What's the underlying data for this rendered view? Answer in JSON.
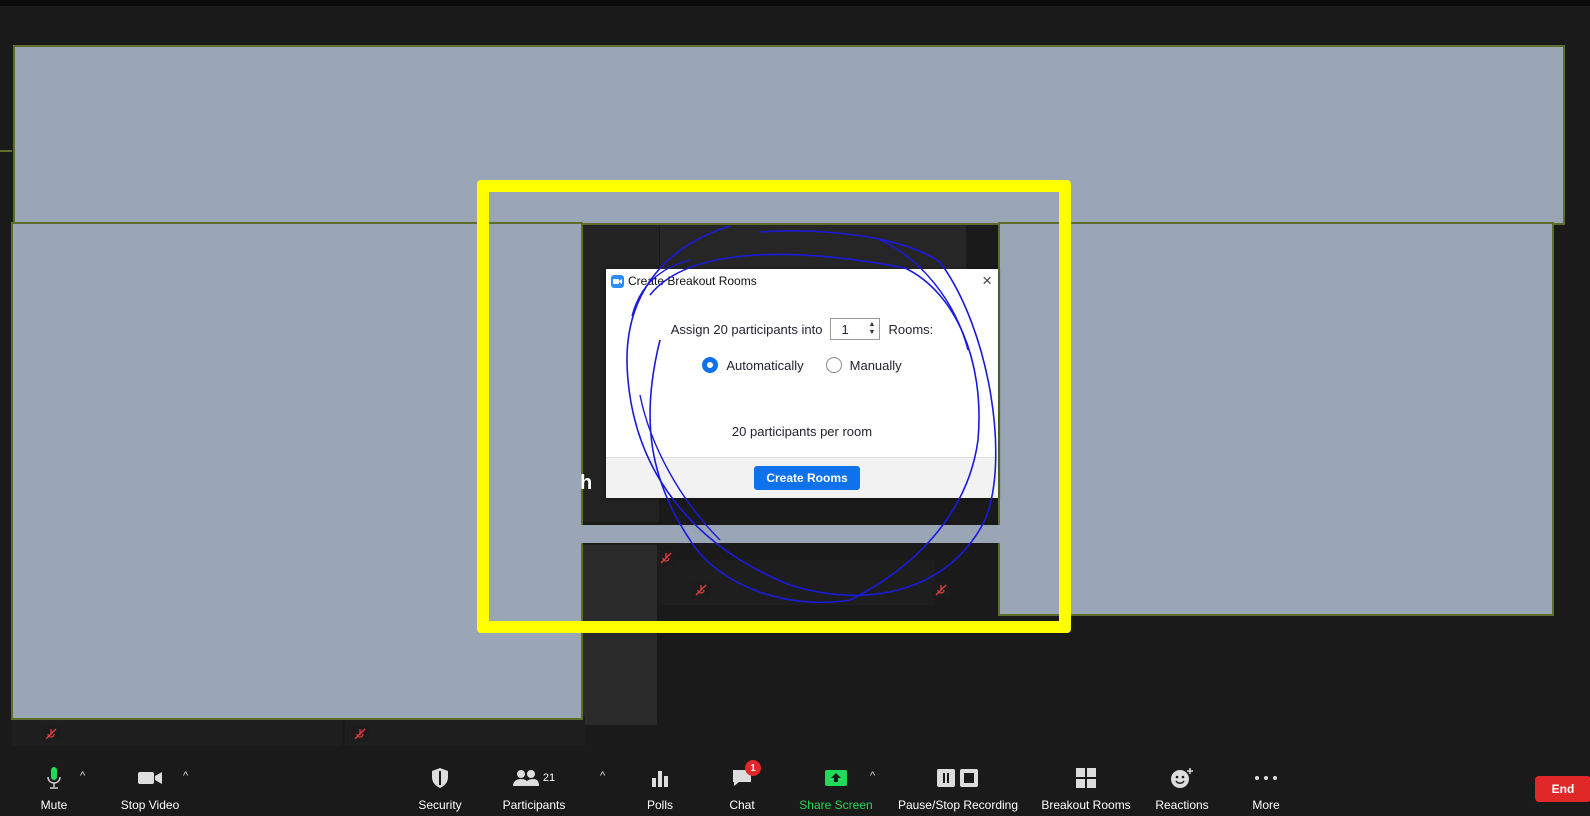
{
  "dialog": {
    "title": "Create Breakout Rooms",
    "close": "×",
    "assign_prefix": "Assign 20 participants into",
    "room_count": "1",
    "assign_suffix": "Rooms:",
    "option_auto": "Automatically",
    "option_manual": "Manually",
    "selected_option": "Automatically",
    "per_room": "20 participants per room",
    "create_button": "Create Rooms"
  },
  "background_text": {
    "partial_name": "h"
  },
  "toolbar": {
    "mute": "Mute",
    "stop_video": "Stop Video",
    "security": "Security",
    "participants": "Participants",
    "participants_count": "21",
    "polls": "Polls",
    "chat": "Chat",
    "chat_badge": "1",
    "share_screen": "Share Screen",
    "recording": "Pause/Stop Recording",
    "breakout_rooms": "Breakout Rooms",
    "reactions": "Reactions",
    "more": "More",
    "end": "End"
  },
  "colors": {
    "accent_blue": "#0e72ed",
    "share_green": "#23d959",
    "end_red": "#e02828",
    "highlight_yellow": "#ffff00",
    "annotation_blue": "#1a1adc",
    "redaction_fill": "#9aa6b5"
  },
  "icons": {
    "mute": "microphone-icon",
    "video": "video-camera-icon",
    "security": "shield-icon",
    "participants": "people-icon",
    "polls": "bar-chart-icon",
    "chat": "speech-bubble-icon",
    "share": "share-arrow-icon",
    "recording": "pause-stop-icon",
    "breakout": "grid-icon",
    "reactions": "emoji-plus-icon",
    "more": "ellipsis-icon"
  }
}
